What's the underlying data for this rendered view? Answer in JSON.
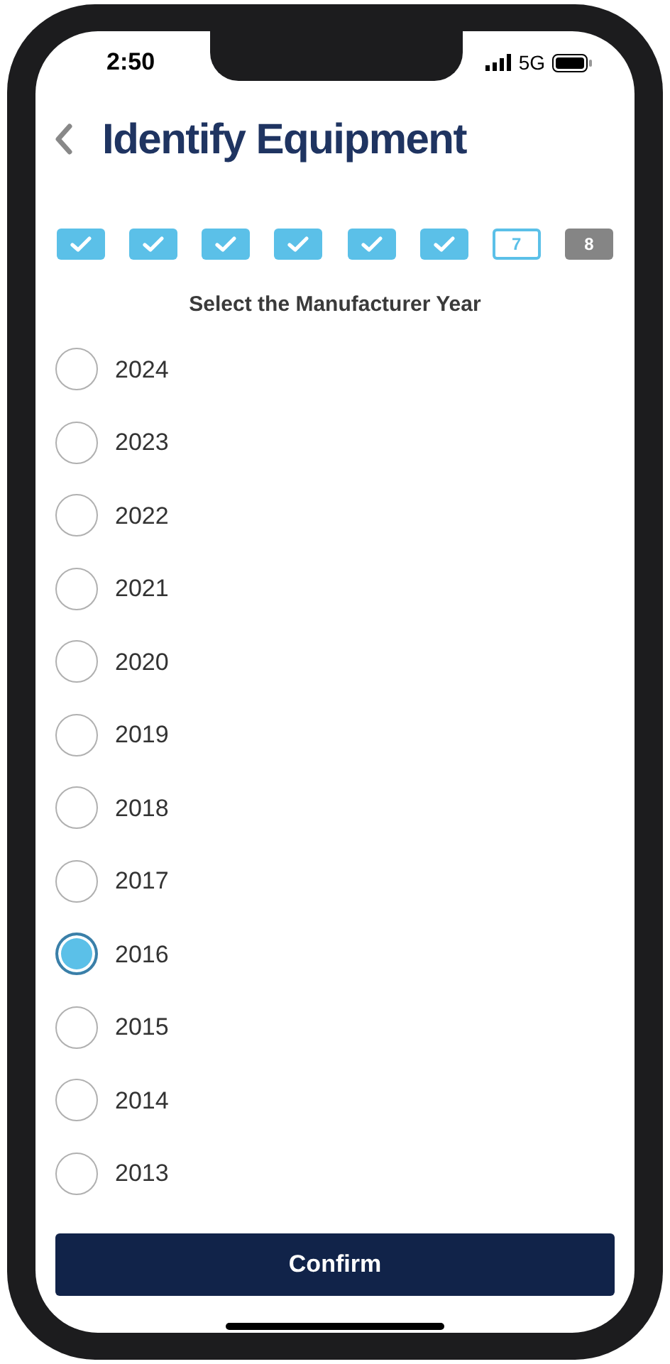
{
  "status_bar": {
    "time": "2:50",
    "network": "5G"
  },
  "header": {
    "title": "Identify Equipment"
  },
  "steps": [
    {
      "kind": "done"
    },
    {
      "kind": "done"
    },
    {
      "kind": "done"
    },
    {
      "kind": "done"
    },
    {
      "kind": "done"
    },
    {
      "kind": "done"
    },
    {
      "kind": "current",
      "label": "7"
    },
    {
      "kind": "pending",
      "label": "8"
    }
  ],
  "prompt": "Select the Manufacturer Year",
  "options": [
    {
      "label": "2024",
      "selected": false
    },
    {
      "label": "2023",
      "selected": false
    },
    {
      "label": "2022",
      "selected": false
    },
    {
      "label": "2021",
      "selected": false
    },
    {
      "label": "2020",
      "selected": false
    },
    {
      "label": "2019",
      "selected": false
    },
    {
      "label": "2018",
      "selected": false
    },
    {
      "label": "2017",
      "selected": false
    },
    {
      "label": "2016",
      "selected": true
    },
    {
      "label": "2015",
      "selected": false
    },
    {
      "label": "2014",
      "selected": false
    },
    {
      "label": "2013",
      "selected": false
    }
  ],
  "confirm_button": "Confirm"
}
